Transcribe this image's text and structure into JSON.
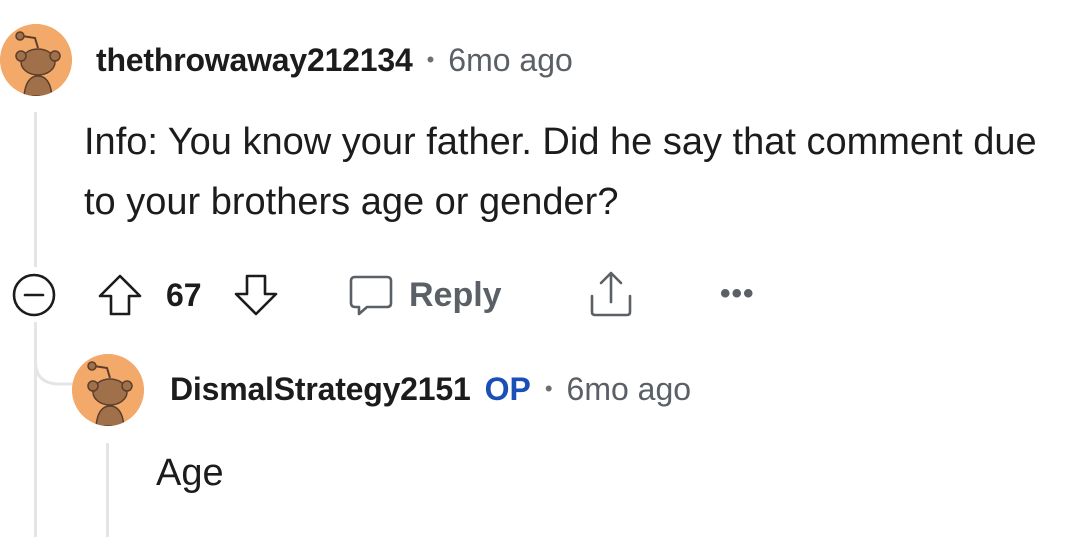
{
  "comment": {
    "username": "thethrowaway212134",
    "separator": "•",
    "time": "6mo ago",
    "body": "Info: You know your father. Did he say that comment due to your brothers age or gender?",
    "score": "67",
    "reply_label": "Reply",
    "more_label": "•••",
    "icons": {
      "collapse": "collapse-minus-icon",
      "upvote": "upvote-arrow-icon",
      "downvote": "downvote-arrow-icon",
      "reply": "speech-bubble-icon",
      "share": "share-icon",
      "more": "more-dots-icon"
    }
  },
  "reply": {
    "username": "DismalStrategy2151",
    "op_badge": "OP",
    "separator": "•",
    "time": "6mo ago",
    "body": "Age"
  },
  "colors": {
    "avatar_bg": "#f3a96a",
    "avatar_figure": "#a0704a",
    "op_badge": "#1a4fb8",
    "meta_gray": "#5a6066",
    "thread_line": "#e5e5e5"
  }
}
